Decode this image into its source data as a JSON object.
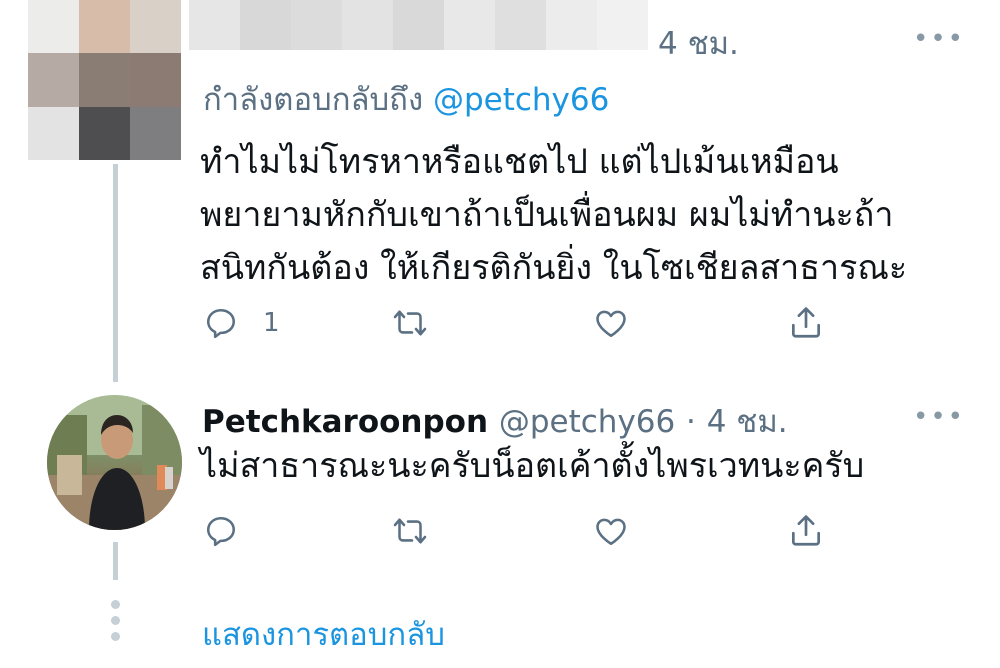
{
  "tweet1": {
    "time": "4 ชม.",
    "replying_prefix": "กำลังตอบกลับถึง",
    "replying_handle": "@petchy66",
    "text_lines": [
      "ทำไมไม่โทรหาหรือแชตไป แต่ไปเม้นเหมือน",
      "พยายามหักกับเขาถ้าเป็นเพื่อนผม ผมไม่ทำนะถ้า",
      "สนิทกันต้อง ให้เกียรติกันยิ่ง ในโซเชียลสาธารณะ"
    ],
    "reply_count": "1",
    "more": "•••"
  },
  "tweet2": {
    "display_name": "Petchkaroonpon",
    "handle": "@petchy66",
    "separator": "·",
    "time": "4 ชม.",
    "text": "ไม่สาธารณะนะครับน็อตเค้าตั้งไพรเวทนะครับ",
    "more": "•••"
  },
  "show_replies": "แสดงการตอบกลับ",
  "icons": {
    "reply": "reply-icon",
    "retweet": "retweet-icon",
    "like": "like-icon",
    "share": "share-icon"
  },
  "colors": {
    "text": "#0f1419",
    "secondary": "#5b7083",
    "link": "#1b95e0",
    "thread_line": "#c4cfd6"
  }
}
